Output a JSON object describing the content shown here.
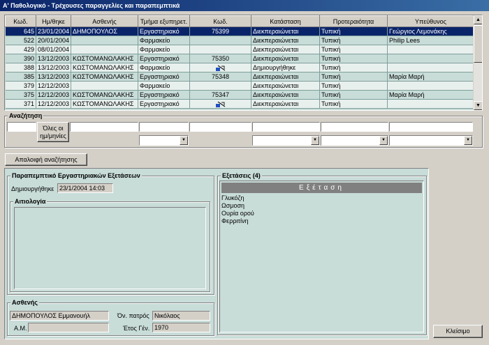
{
  "window": {
    "title": "A' Παθολογικό - Τρέχουσες παραγγελίες και παραπεμπτικά"
  },
  "grid": {
    "columns": [
      "Κωδ.",
      "Ημ/θηκε",
      "Ασθενής",
      "Τμήμα εξυπηρετ.",
      "Κωδ.",
      "Κατάσταση",
      "Προτεραιότητα",
      "Υπεύθυνος"
    ],
    "rows": [
      [
        "645",
        "23/01/2004",
        "ΔΗΜΟΠΟΥΛΟΣ",
        "Εργαστηριακό",
        "75399",
        "Διεκπεραιώνεται",
        "Τυπική",
        "Γεώργιος Λεμονάκης"
      ],
      [
        "522",
        "20/01/2004",
        "",
        "Φαρμακείο",
        "",
        "Διεκπεραιώνεται",
        "Τυπική",
        "Philip Lees"
      ],
      [
        "429",
        "08/01/2004",
        "",
        "Φαρμακείο",
        "",
        "Διεκπεραιώνεται",
        "Τυπική",
        ""
      ],
      [
        "390",
        "13/12/2003",
        "ΚΩΣΤΟΜΑΝΩΛΑΚΗΣ",
        "Εργαστηριακό",
        "75350",
        "Διεκπεραιώνεται",
        "Τυπική",
        ""
      ],
      [
        "388",
        "13/12/2003",
        "ΚΩΣΤΟΜΑΝΩΛΑΚΗΣ",
        "Φαρμακείο",
        "",
        "Δημιουργήθηκε",
        "Τυπική",
        ""
      ],
      [
        "385",
        "13/12/2003",
        "ΚΩΣΤΟΜΑΝΩΛΑΚΗΣ",
        "Εργαστηριακό",
        "75348",
        "Διεκπεραιώνεται",
        "Τυπική",
        "Μαρία Μαρή"
      ],
      [
        "379",
        "12/12/2003",
        "",
        "Φαρμακείο",
        "",
        "Διεκπεραιώνεται",
        "Τυπική",
        ""
      ],
      [
        "375",
        "12/12/2003",
        "ΚΩΣΤΟΜΑΝΩΛΑΚΗΣ",
        "Εργαστηριακό",
        "75347",
        "Διεκπεραιώνεται",
        "Τυπική",
        "Μαρία Μαρή"
      ],
      [
        "371",
        "12/12/2003",
        "ΚΩΣΤΟΜΑΝΩΛΑΚΗΣ",
        "Εργαστηριακό",
        "",
        "Διεκπεραιώνεται",
        "Τυπική",
        ""
      ]
    ],
    "icon_rows": [
      4,
      8
    ],
    "selected_row": 0
  },
  "search": {
    "title": "Αναζήτηση",
    "all_dates_label": "Όλες οι ημ/μηνίες",
    "clear_label": "Απαλοιφή αναζήτησης"
  },
  "referral": {
    "title": "Παραπεμπτικό Εργαστηριακών Εξετάσεων",
    "created_label": "Δημιουργήθηκε",
    "created_value": "23/1/2004 14:03",
    "reason_title": "Αιτιολογία",
    "reason_value": ""
  },
  "exams": {
    "title": "Εξετάσεις (4)",
    "header": "Εξέταση",
    "items": [
      "Γλυκόζη",
      "Ωσμοση",
      "Ουρία ορού",
      "Φερριτίνη"
    ]
  },
  "patient": {
    "title": "Ασθενής",
    "name_value": "ΔΗΜΟΠΟΥΛΟΣ Εμμανουήλ",
    "father_label": "Όν. πατρός",
    "father_value": "Νικόλαος",
    "am_label": "Α.Μ.",
    "am_value": "",
    "birth_label": "Έτος Γέν.",
    "birth_value": "1970"
  },
  "close_label": "Κλείσιμο",
  "colors": {
    "selection": "#0a246a",
    "panel_teal": "#c8dcd8",
    "row_alt": "#e8f0ee"
  }
}
